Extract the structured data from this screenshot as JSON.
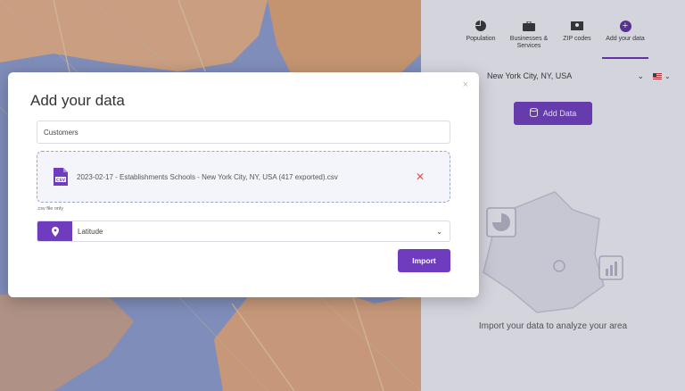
{
  "panel": {
    "tabs": [
      {
        "label": "Population",
        "icon": "pie-chart-icon"
      },
      {
        "label": "Businesses & Services",
        "icon": "briefcase-icon"
      },
      {
        "label": "ZIP codes",
        "icon": "map-pin-icon"
      },
      {
        "label": "Add your data",
        "icon": "plus-circle-icon"
      }
    ],
    "location": "New York City, NY, USA",
    "add_data_label": "Add Data",
    "empty_message": "Import your data to analyze your area"
  },
  "modal": {
    "title": "Add your data",
    "close_label": "×",
    "name_value": "Customers",
    "file_name": "2023-02-17 - Establishments Schools - New York City, NY, USA (417 exported).csv",
    "file_type_badge": "CSV",
    "remove_label": "✕",
    "hint": ".csv file only",
    "field_value": "Latitude",
    "import_label": "Import"
  },
  "colors": {
    "accent": "#6f3cc0",
    "danger": "#d9534f"
  }
}
